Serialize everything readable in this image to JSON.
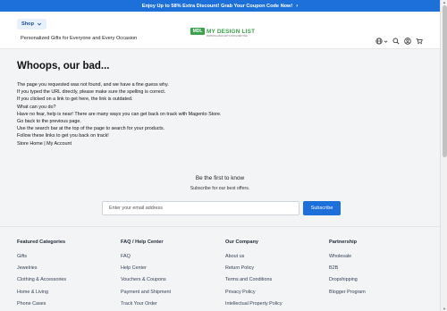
{
  "announcement": {
    "text": "Enjoy Up to 58% Extra Discount! Grab Your Coupon Code Now!",
    "chevron_icon": "chevron-right-icon"
  },
  "header": {
    "shop_label": "Shop",
    "tagline": "Personalized Gifts for Everyone and Every Occasion",
    "logo_mark": "MDL",
    "logo_text": "MY DESIGN LIST",
    "logo_subtext": "PERSONALIZED GIFTS FOR EVERYONE",
    "icons": [
      "globe-icon",
      "chevron-down-icon",
      "search-icon",
      "account-icon",
      "cart-icon"
    ]
  },
  "error_page": {
    "title": "Whoops, our bad...",
    "lines": [
      "The page you requested was not found, and we have a fine guess why.",
      "If you typed the URL directly, please make sure the spelling is correct.",
      "If you clicked on a link to get here, the link is outdated.",
      "What can you do?",
      "Have no fear, help is near! There are many ways you can get back on track with Magento Store.",
      "Go back to the previous page.",
      "Use the search bar at the top of the page to search for your products.",
      "Follow these links to get you back on track!"
    ],
    "store_home": "Store Home",
    "separator": "|",
    "my_account": "My Account"
  },
  "newsletter": {
    "title": "Be the first to know",
    "subtitle": "Subscribe for our best offers.",
    "email_placeholder": "Enter your email address",
    "button_label": "Subscribe"
  },
  "footer": {
    "columns": [
      {
        "title": "Featured Categories",
        "items": [
          "Gifts",
          "Jewelries",
          "Clothing & Accessories",
          "Home & Living",
          "Phone Cases"
        ]
      },
      {
        "title": "FAQ / Help Center",
        "items": [
          "FAQ",
          "Help Center",
          "Vouchers & Coupons",
          "Payment and Shipment",
          "Track Your Order"
        ]
      },
      {
        "title": "Our Company",
        "items": [
          "About us",
          "Return Policy",
          "Terms and Conditions",
          "Privacy Policy",
          "Intellectual Property Policy"
        ]
      },
      {
        "title": "Partnership",
        "items": [
          "Wholesale",
          "B2B",
          "Dropshipping",
          "Blogger Program"
        ]
      }
    ]
  },
  "colors": {
    "accent": "#1d6fd9",
    "brand_green": "#3aa34a",
    "background": "#f3f4f6"
  }
}
